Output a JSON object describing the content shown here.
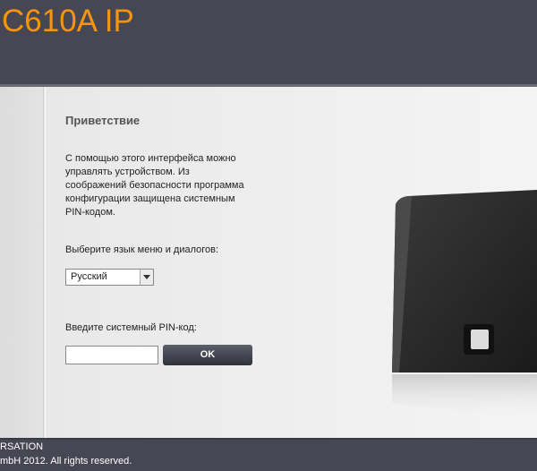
{
  "header": {
    "title": "C610A IP"
  },
  "login": {
    "heading": "Приветствие",
    "intro": "С помощью этого интерфейса можно\nуправлять устройством. Из\nсоображений безопасности программа\nконфигурации защищена системным\nPIN-кодом.",
    "language_label": "Выберите язык меню и диалогов:",
    "language_selected": "Русский",
    "pin_label": "Введите системный PIN-код:",
    "pin_value": "",
    "ok_label": "OK"
  },
  "footer": {
    "line1": "RSATION",
    "line2": "mbH 2012. All rights reserved."
  },
  "colors": {
    "accent": "#f5940e",
    "header_bg": "#474754"
  }
}
